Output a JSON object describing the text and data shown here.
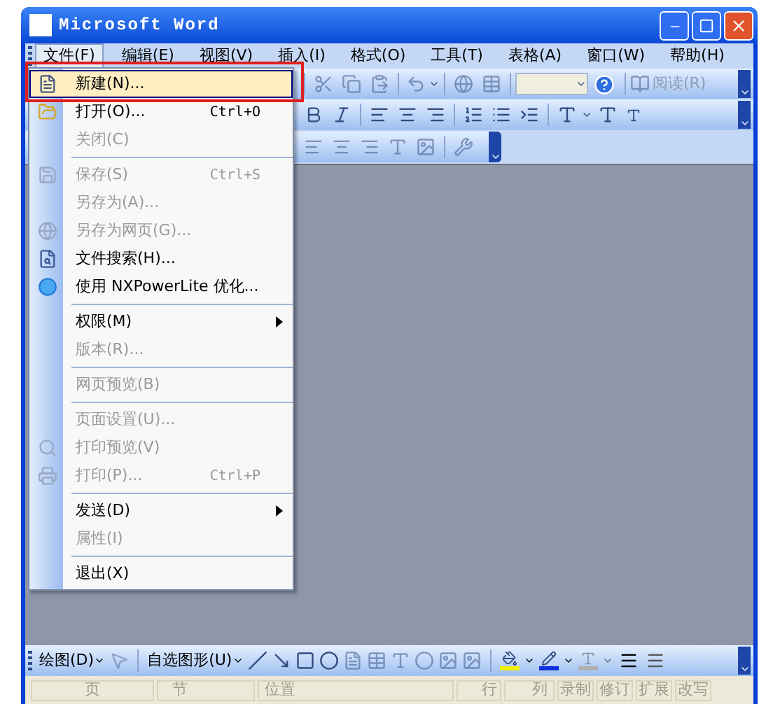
{
  "window": {
    "title": "Microsoft Word"
  },
  "menu_bar": [
    {
      "label": "文件(F)",
      "selected": true
    },
    {
      "label": "编辑(E)",
      "selected": false
    },
    {
      "label": "视图(V)",
      "selected": false
    },
    {
      "label": "插入(I)",
      "selected": false
    },
    {
      "label": "格式(O)",
      "selected": false
    },
    {
      "label": "工具(T)",
      "selected": false
    },
    {
      "label": "表格(A)",
      "selected": false
    },
    {
      "label": "窗口(W)",
      "selected": false
    },
    {
      "label": "帮助(H)",
      "selected": false
    }
  ],
  "standard_toolbar": {
    "read_button": "阅读(R)"
  },
  "file_menu": {
    "groups": [
      [
        {
          "label": "新建(N)...",
          "disabled": false,
          "selected": true,
          "submenu": false
        },
        {
          "label": "打开(O)...",
          "shortcut": "Ctrl+O",
          "disabled": false,
          "selected": false,
          "submenu": false
        },
        {
          "label": "关闭(C)",
          "disabled": true,
          "selected": false,
          "submenu": false
        }
      ],
      [
        {
          "label": "保存(S)",
          "shortcut": "Ctrl+S",
          "disabled": true,
          "selected": false,
          "submenu": false
        },
        {
          "label": "另存为(A)...",
          "disabled": true,
          "selected": false,
          "submenu": false
        },
        {
          "label": "另存为网页(G)...",
          "disabled": true,
          "selected": false,
          "submenu": false
        },
        {
          "label": "文件搜索(H)...",
          "disabled": false,
          "selected": false,
          "submenu": false
        },
        {
          "label": "使用 NXPowerLite 优化...",
          "disabled": false,
          "selected": false,
          "submenu": false
        }
      ],
      [
        {
          "label": "权限(M)",
          "disabled": false,
          "selected": false,
          "submenu": true
        },
        {
          "label": "版本(R)...",
          "disabled": true,
          "selected": false,
          "submenu": false
        }
      ],
      [
        {
          "label": "网页预览(B)",
          "disabled": true,
          "selected": false,
          "submenu": false
        }
      ],
      [
        {
          "label": "页面设置(U)...",
          "disabled": true,
          "selected": false,
          "submenu": false
        },
        {
          "label": "打印预览(V)",
          "disabled": true,
          "selected": false,
          "submenu": false
        },
        {
          "label": "打印(P)...",
          "shortcut": "Ctrl+P",
          "disabled": true,
          "selected": false,
          "submenu": false
        }
      ],
      [
        {
          "label": "发送(D)",
          "disabled": false,
          "selected": false,
          "submenu": true
        },
        {
          "label": "属性(I)",
          "disabled": true,
          "selected": false,
          "submenu": false
        }
      ],
      [
        {
          "label": "退出(X)",
          "disabled": false,
          "selected": false,
          "submenu": false
        }
      ]
    ]
  },
  "drawing_toolbar": {
    "draw_menu": "绘图(D)",
    "autoshapes_menu": "自选图形(U)"
  },
  "status_bar": [
    "页",
    "节",
    "位置",
    "行",
    "列",
    "录制",
    "修订",
    "扩展",
    "改写"
  ]
}
